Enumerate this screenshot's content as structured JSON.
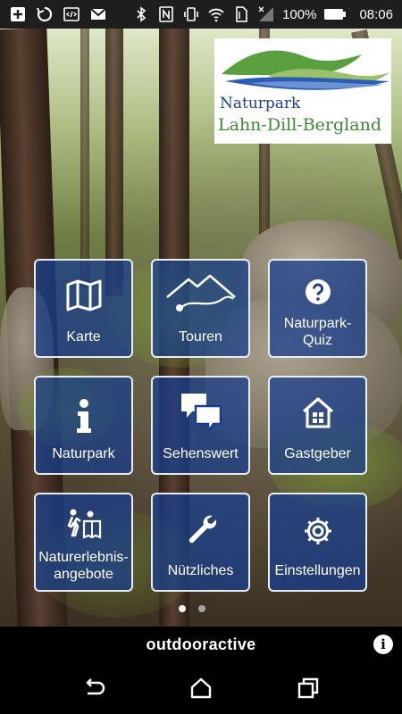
{
  "status_bar": {
    "battery_percent": "100%",
    "time": "08:06",
    "left_icons": [
      "add-icon",
      "sync-icon",
      "code-icon",
      "gmail-icon"
    ],
    "right_icons": [
      "bluetooth-icon",
      "nfc-icon",
      "vibrate-icon",
      "wifi-icon",
      "sim-icon",
      "signal-icon",
      "battery-icon"
    ]
  },
  "logo": {
    "line1": "Naturpark",
    "line2": "Lahn-Dill-Bergland",
    "colors": {
      "blue": "#1f3f8c",
      "green": "#3d8a32"
    }
  },
  "tiles": [
    {
      "label": "Karte",
      "icon": "map-icon"
    },
    {
      "label": "Touren",
      "icon": "tour-route-icon"
    },
    {
      "label": "Naturpark-\nQuiz",
      "icon": "question-icon"
    },
    {
      "label": "Naturpark",
      "icon": "info-icon"
    },
    {
      "label": "Sehenswert",
      "icon": "speech-bubbles-icon"
    },
    {
      "label": "Gastgeber",
      "icon": "house-icon"
    },
    {
      "label": "Naturerlebnis-\nangebote",
      "icon": "hikers-icon"
    },
    {
      "label": "Nützliches",
      "icon": "wrench-icon"
    },
    {
      "label": "Einstellungen",
      "icon": "gear-icon"
    }
  ],
  "tile_color": "#183e8c",
  "brand": {
    "name": "outdooractive",
    "info_icon": "info-icon"
  },
  "nav": {
    "back": "back-icon",
    "home": "home-icon",
    "recents": "recents-icon"
  }
}
